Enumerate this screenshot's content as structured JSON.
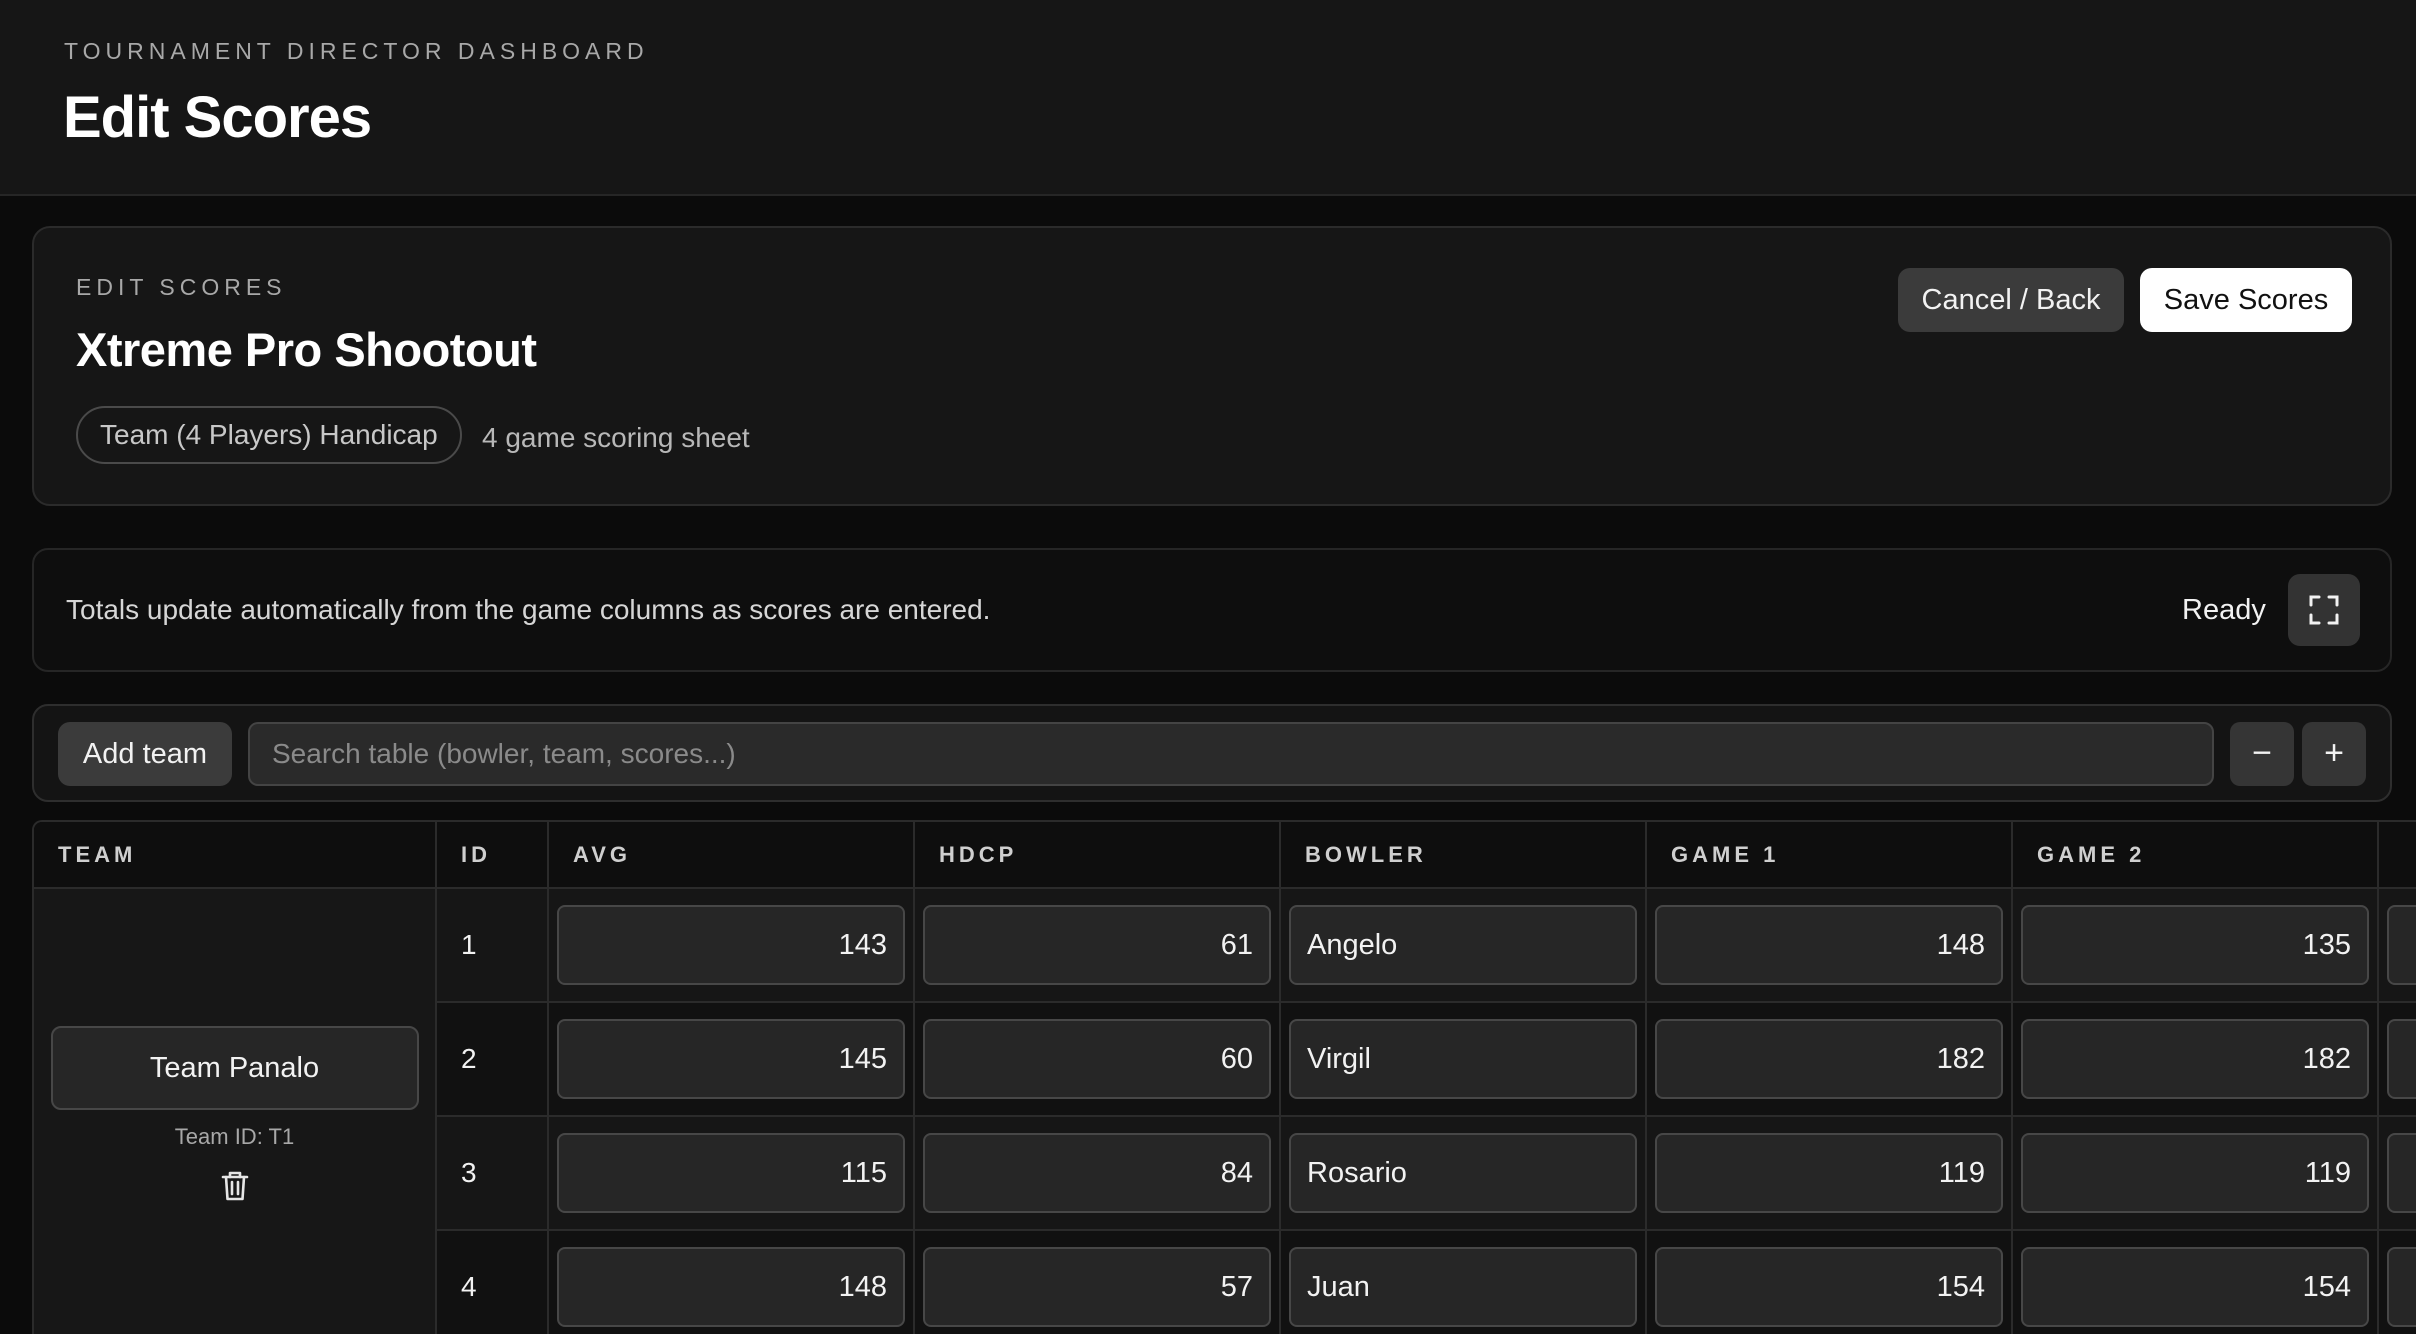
{
  "header": {
    "eyebrow": "TOURNAMENT DIRECTOR DASHBOARD",
    "title": "Edit Scores"
  },
  "event": {
    "eyebrow": "EDIT SCORES",
    "name": "Xtreme Pro Shootout",
    "format": "Team (4 Players) Handicap",
    "sheet_note": "4 game scoring sheet",
    "cancel_label": "Cancel / Back",
    "save_label": "Save Scores"
  },
  "status": {
    "message": "Totals update automatically from the game columns as scores are entered.",
    "state": "Ready"
  },
  "toolbar": {
    "add_team_label": "Add team",
    "search_placeholder": "Search table (bowler, team, scores...)",
    "zoom_out_label": "−",
    "zoom_in_label": "+"
  },
  "table": {
    "columns": [
      "TEAM",
      "ID",
      "AVG",
      "HDCP",
      "BOWLER",
      "GAME 1",
      "GAME 2"
    ],
    "team": {
      "name": "Team Panalo",
      "id_label": "Team ID: T1"
    },
    "rows": [
      {
        "id": "1",
        "avg": "143",
        "hdcp": "61",
        "bowler": "Angelo",
        "game1": "148",
        "game2": "135"
      },
      {
        "id": "2",
        "avg": "145",
        "hdcp": "60",
        "bowler": "Virgil",
        "game1": "182",
        "game2": "182"
      },
      {
        "id": "3",
        "avg": "115",
        "hdcp": "84",
        "bowler": "Rosario",
        "game1": "119",
        "game2": "119"
      },
      {
        "id": "4",
        "avg": "148",
        "hdcp": "57",
        "bowler": "Juan",
        "game1": "154",
        "game2": "154"
      }
    ]
  },
  "icons": {
    "fullscreen": "fullscreen-icon",
    "delete": "trash-icon"
  },
  "colors": {
    "background": "#0b0b0b",
    "panel": "#161616",
    "primary_button": "#ffffff",
    "secondary_button": "#3b3b3b"
  }
}
